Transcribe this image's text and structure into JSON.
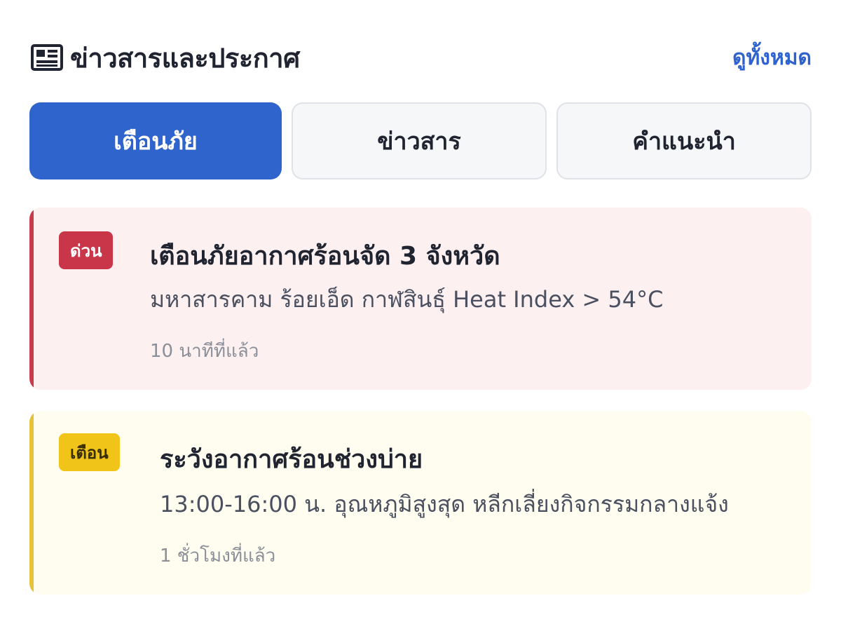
{
  "header": {
    "title": "ข่าวสารและประกาศ",
    "icon": "newspaper-icon",
    "view_all": "ดูทั้งหมด"
  },
  "tabs": [
    {
      "label": "เตือนภัย",
      "active": true
    },
    {
      "label": "ข่าวสาร",
      "active": false
    },
    {
      "label": "คำแนะนำ",
      "active": false
    }
  ],
  "alerts": [
    {
      "badge": "ด่วน",
      "level": "urgent",
      "title": "เตือนภัยอากาศร้อนจัด 3 จังหวัด",
      "description": "มหาสารคาม ร้อยเอ็ด กาฬสินธุ์ Heat Index > 54°C",
      "time": "10 นาทีที่แล้ว"
    },
    {
      "badge": "เตือน",
      "level": "warning",
      "title": "ระวังอากาศร้อนช่วงบ่าย",
      "description": "13:00-16:00 น. อุณหภูมิสูงสุด หลีกเลี่ยงกิจกรรมกลางแจ้ง",
      "time": "1 ชั่วโมงที่แล้ว"
    }
  ],
  "colors": {
    "accent": "#2f64cc",
    "urgent": "#c9364a",
    "warning": "#f1c419",
    "link": "#2e63cf"
  }
}
